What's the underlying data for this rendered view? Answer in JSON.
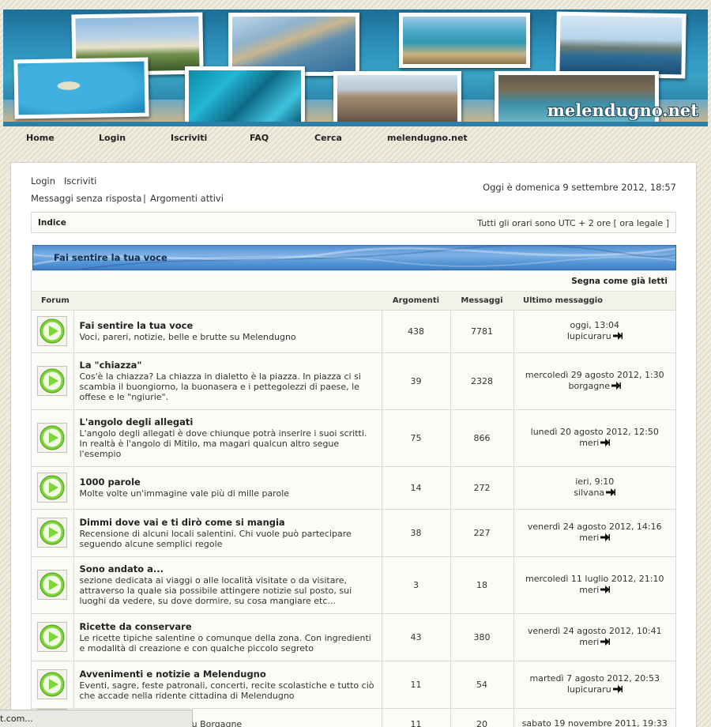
{
  "banner": {
    "site_name": "melendugno.net"
  },
  "nav": [
    "Home",
    "Login",
    "Iscriviti",
    "FAQ",
    "Cerca",
    "melendugno.net"
  ],
  "top_links": {
    "login": "Login",
    "register": "Iscriviti",
    "unanswered": "Messaggi senza risposta",
    "separator": "|",
    "active": "Argomenti attivi"
  },
  "datetime": "Oggi è domenica 9 settembre 2012, 18:57",
  "crumb": {
    "home": "Indice",
    "timezone": "Tutti gli orari sono UTC + 2 ore [ ora legale ]"
  },
  "category": {
    "title": "Fai sentire la tua voce",
    "mark_read": "Segna come già letti"
  },
  "columns": {
    "forum": "Forum",
    "topics": "Argomenti",
    "posts": "Messaggi",
    "last": "Ultimo messaggio"
  },
  "forums": [
    {
      "name": "Fai sentire la tua voce",
      "desc": "Voci, pareri, notizie, belle e brutte su Melendugno",
      "topics": "438",
      "posts": "7781",
      "last_date": "oggi, 13:04",
      "last_user": "lupicuraru"
    },
    {
      "name": "La \"chiazza\"",
      "desc": "Cos'è la chiazza? La chiazza in dialetto è la piazza. In piazza ci si scambia il buongiorno, la buonasera e i pettegolezzi di paese, le offese e le \"ngiurie\".",
      "topics": "39",
      "posts": "2328",
      "last_date": "mercoledì 29 agosto 2012, 1:30",
      "last_user": "borgagne"
    },
    {
      "name": "L'angolo degli allegati",
      "desc": "L'angolo degli allegati è dove chiunque potrà inserire i suoi scritti. In realtà è l'angolo di Mitilo, ma magari qualcun altro segue l'esempio",
      "topics": "75",
      "posts": "866",
      "last_date": "lunedì 20 agosto 2012, 12:50",
      "last_user": "meri"
    },
    {
      "name": "1000 parole",
      "desc": "Molte volte un'immagine vale più di mille parole",
      "topics": "14",
      "posts": "272",
      "last_date": "ieri, 9:10",
      "last_user": "silvana"
    },
    {
      "name": "Dimmi dove vai e ti dirò come si mangia",
      "desc": "Recensione di alcuni locali salentini. Chi vuole può partecipare seguendo alcune semplici regole",
      "topics": "38",
      "posts": "227",
      "last_date": "venerdì 24 agosto 2012, 14:16",
      "last_user": "meri"
    },
    {
      "name": "Sono andato a...",
      "desc": "sezione dedicata ai viaggi o alle località visitate o da visitare, attraverso la quale sia possibile attingere notizie sul posto, sui luoghi da vedere, su dove dormire, su cosa mangiare etc...",
      "topics": "3",
      "posts": "18",
      "last_date": "mercoledì 11 luglio 2012, 21:10",
      "last_user": "meri"
    },
    {
      "name": "Ricette da conservare",
      "desc": "Le ricette tipiche salentine o comunque della zona. Con ingredienti e modalità di creazione e con qualche piccolo segreto",
      "topics": "43",
      "posts": "380",
      "last_date": "venerdì 24 agosto 2012, 10:41",
      "last_user": "meri"
    },
    {
      "name": "Avvenimenti e notizie a Melendugno",
      "desc": "Eventi, sagre, feste patronali, concerti, recite scolastiche e tutto ciò che accade nella ridente cittadina di Melendugno",
      "topics": "11",
      "posts": "54",
      "last_date": "martedì 7 agosto 2012, 20:53",
      "last_user": "lupicuraru"
    },
    {
      "name": "",
      "desc": "...enimenti, belli e brutti su Borgagne",
      "topics": "11",
      "posts": "20",
      "last_date": "sabato 19 novembre 2011, 19:33",
      "last_user": ""
    }
  ],
  "status_bar": "t.com...",
  "colors": {
    "category_bar": "#5796d6",
    "nav_text": "#222222",
    "go_icon": "#111111",
    "play_icon": "#7fd43a"
  }
}
